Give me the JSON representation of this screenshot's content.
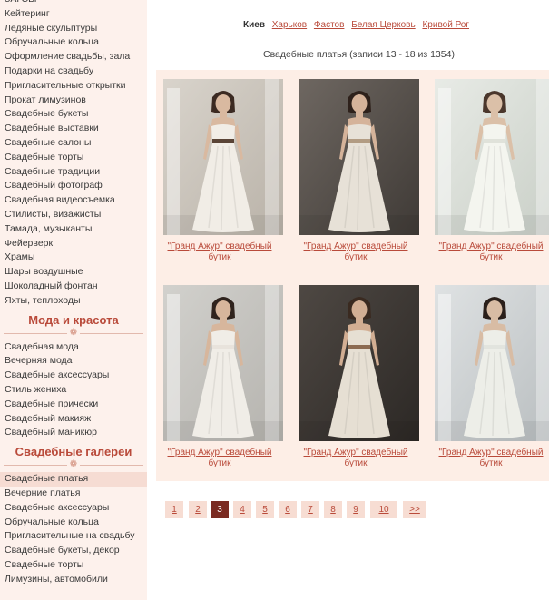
{
  "sidebar": {
    "items_a": [
      "ЗАГСЫ",
      "Кейтеринг",
      "Ледяные скульптуры",
      "Обручальные кольца",
      "Оформление свадьбы, зала",
      "Подарки на свадьбу",
      "Пригласительные открытки",
      "Прокат лимузинов",
      "Свадебные букеты",
      "Свадебные выставки",
      "Свадебные салоны",
      "Свадебные торты",
      "Свадебные традиции",
      "Свадебный фотограф",
      "Свадебная видеосъемка",
      "Стилисты, визажисты",
      "Тамада, музыканты",
      "Фейерверк",
      "Храмы",
      "Шары воздушные",
      "Шоколадный фонтан",
      "Яхты, теплоходы"
    ],
    "section_fashion": "Мода и красота",
    "items_b": [
      "Свадебная мода",
      "Вечерняя мода",
      "Свадебные аксессуары",
      "Стиль жениха",
      "Свадебные прически",
      "Свадебный макияж",
      "Свадебный маникюр"
    ],
    "section_galleries": "Свадебные галереи",
    "items_c": [
      "Свадебные платья",
      "Вечерние платья",
      "Свадебные аксессуары",
      "Обручальные кольца",
      "Пригласительные на свадьбу",
      "Свадебные букеты, декор",
      "Свадебные торты",
      "Лимузины, автомобили"
    ]
  },
  "cities": {
    "current": "Киев",
    "links": [
      "Харьков",
      "Фастов",
      "Белая Церковь",
      "Кривой Рог"
    ]
  },
  "records": "Свадебные платья (записи 13 - 18 из 1354)",
  "gallery": {
    "caption_line1": "\"Гранд Ажур\" свадебный",
    "caption_line2": "бутик",
    "photos": [
      "dress-photo-1",
      "dress-photo-2",
      "dress-photo-3",
      "dress-photo-4",
      "dress-photo-5",
      "dress-photo-6"
    ]
  },
  "pagination": {
    "pages": [
      "1",
      "2",
      "3",
      "4",
      "5",
      "6",
      "7",
      "8",
      "9",
      "10",
      ">>"
    ],
    "current": "3"
  },
  "colors": {
    "accent": "#b94a3a",
    "sidebar_bg": "#fdf1ec",
    "gallery_bg": "#fdeee6",
    "active_page": "#7a2b22"
  }
}
